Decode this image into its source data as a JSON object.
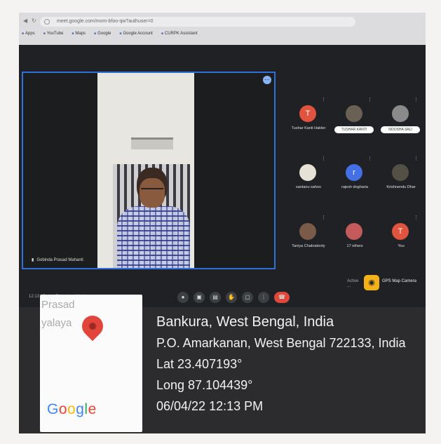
{
  "browser": {
    "url": "meet.google.com/mom-bfoo-qw?authuser=0",
    "bookmarks": [
      "Apps",
      "YouTube",
      "Maps",
      "Google",
      "Google Account",
      "CURPK Assistant"
    ]
  },
  "meeting": {
    "speaker_name": "Gobinda Prasad Mahanti",
    "meeting_code": "12:13 | Digital Education Webinar",
    "participants": [
      {
        "name": "Tushar Kanti Halder",
        "avatar_letter": "T",
        "avatar_color": "#e0533f",
        "style": "name"
      },
      {
        "name": "TUSHAR KANTI",
        "avatar_letter": "",
        "avatar_color": "#6b6054",
        "style": "pill"
      },
      {
        "name": "NOOSHA SALI",
        "avatar_letter": "",
        "avatar_color": "#8a8a8a",
        "style": "pill"
      },
      {
        "name": "santanu sahoo",
        "avatar_letter": "",
        "avatar_color": "#e6e2d6",
        "style": "name"
      },
      {
        "name": "rajesh dogharia",
        "avatar_letter": "r",
        "avatar_color": "#4470e6",
        "style": "name"
      },
      {
        "name": "Krishnendu Dhar",
        "avatar_letter": "",
        "avatar_color": "#555046",
        "style": "name"
      },
      {
        "name": "Taniya Chakraborty",
        "avatar_letter": "",
        "avatar_color": "#7a5a48",
        "style": "name"
      },
      {
        "name": "17 others",
        "avatar_letter": "",
        "avatar_color": "#c45a5a",
        "style": "name"
      },
      {
        "name": "You",
        "avatar_letter": "T",
        "avatar_color": "#e0533f",
        "style": "name"
      }
    ],
    "active_label": "Active ...",
    "gps_camera_label": "GPS Map Camera"
  },
  "geotag": {
    "thumbnail_text": [
      "Prasad",
      "yalaya"
    ],
    "google_letters": [
      "G",
      "o",
      "o",
      "g",
      "l",
      "e"
    ],
    "location_title": "Bankura, West Bengal, India",
    "address": "P.O. Amarkanan, West Bengal 722133, India",
    "latitude": "Lat 23.407193°",
    "longitude": "Long 87.104439°",
    "datetime": "06/04/22 12:13 PM"
  }
}
